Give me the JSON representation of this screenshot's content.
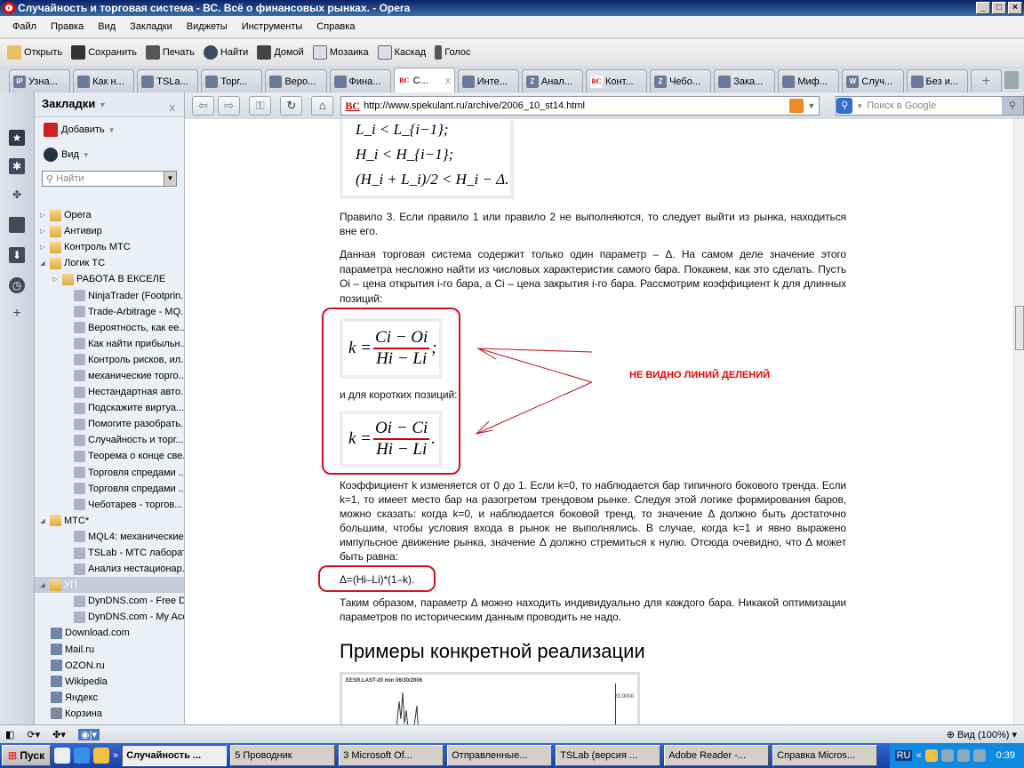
{
  "window": {
    "title": "Случайность и торговая система - ВС. Всё о финансовых рынках. - Opera",
    "controls": [
      "_",
      "□",
      "×"
    ]
  },
  "menu": [
    "Файл",
    "Правка",
    "Вид",
    "Закладки",
    "Виджеты",
    "Инструменты",
    "Справка"
  ],
  "toolbar": [
    "Открыть",
    "Сохранить",
    "Печать",
    "Найти",
    "Домой",
    "Мозаика",
    "Каскад",
    "Голос"
  ],
  "tabs": [
    {
      "label": "Узна...",
      "icon": "IP"
    },
    {
      "label": "Как н...",
      "icon": ""
    },
    {
      "label": "TSLa...",
      "icon": ""
    },
    {
      "label": "Торг...",
      "icon": ""
    },
    {
      "label": "Веро...",
      "icon": ""
    },
    {
      "label": "Фина...",
      "icon": ""
    },
    {
      "label": "С...",
      "icon": "BC",
      "active": true
    },
    {
      "label": "Инте...",
      "icon": ""
    },
    {
      "label": "Анал...",
      "icon": "Z"
    },
    {
      "label": "Конт...",
      "icon": "BC"
    },
    {
      "label": "Чебо...",
      "icon": "Z"
    },
    {
      "label": "Зака...",
      "icon": ""
    },
    {
      "label": "Миф...",
      "icon": ""
    },
    {
      "label": "Случ...",
      "icon": "W"
    },
    {
      "label": "Без и...",
      "icon": ""
    }
  ],
  "tab_close": "x",
  "new_tab": "+",
  "address": {
    "url": "http://www.spekulant.ru/archive/2006_10_st14.html",
    "site_badge": "BC",
    "search_placeholder": "Поиск в Google"
  },
  "panel": {
    "title": "Закладки",
    "close": "x",
    "add": "Добавить",
    "view": "Вид",
    "find_placeholder": "Найти"
  },
  "bookmarks": [
    {
      "label": "Opera",
      "level": 0,
      "type": "folder",
      "arrow": "▷"
    },
    {
      "label": "Антивир",
      "level": 0,
      "type": "folder",
      "arrow": "▷"
    },
    {
      "label": "Контроль МТС",
      "level": 0,
      "type": "folder",
      "arrow": "▷"
    },
    {
      "label": "Логик ТС",
      "level": 0,
      "type": "folder",
      "arrow": "◢"
    },
    {
      "label": "РАБОТА В ЕКСЕЛЕ",
      "level": 1,
      "type": "folder",
      "arrow": "▷"
    },
    {
      "label": "NinjaTrader (Footprin...",
      "level": 2,
      "type": "page"
    },
    {
      "label": "Trade-Arbitrage - MQ...",
      "level": 2,
      "type": "page"
    },
    {
      "label": "Вероятность, как ее...",
      "level": 2,
      "type": "page"
    },
    {
      "label": "Как найти прибыльн...",
      "level": 2,
      "type": "page"
    },
    {
      "label": "Контроль рисков, ил...",
      "level": 2,
      "type": "page"
    },
    {
      "label": "механические торго...",
      "level": 2,
      "type": "page"
    },
    {
      "label": "Нестандартная авто...",
      "level": 2,
      "type": "page"
    },
    {
      "label": "Подскажите виртуа...",
      "level": 2,
      "type": "page"
    },
    {
      "label": "Помогите разобрать...",
      "level": 2,
      "type": "page"
    },
    {
      "label": "Случайность и торг...",
      "level": 2,
      "type": "page"
    },
    {
      "label": "Теорема о конце све...",
      "level": 2,
      "type": "page"
    },
    {
      "label": "Торговля спредами ...",
      "level": 2,
      "type": "page"
    },
    {
      "label": "Торговля спредами ...",
      "level": 2,
      "type": "page"
    },
    {
      "label": "Чеботарев - торгов...",
      "level": 2,
      "type": "page"
    },
    {
      "label": "МТС*",
      "level": 0,
      "type": "folder",
      "arrow": "◢"
    },
    {
      "label": "MQL4: механические...",
      "level": 2,
      "type": "page"
    },
    {
      "label": "TSLab - МТС лаборат...",
      "level": 2,
      "type": "page"
    },
    {
      "label": "Анализ нестационар...",
      "level": 2,
      "type": "page"
    },
    {
      "label": "УП",
      "level": 0,
      "type": "folder",
      "arrow": "◢",
      "selected": true
    },
    {
      "label": "DynDNS.com - Free D...",
      "level": 2,
      "type": "page"
    },
    {
      "label": "DynDNS.com - My Acc...",
      "level": 2,
      "type": "page"
    },
    {
      "label": "Download.com",
      "level": 1,
      "type": "page"
    },
    {
      "label": "Mail.ru",
      "level": 1,
      "type": "page"
    },
    {
      "label": "OZON.ru",
      "level": 1,
      "type": "page"
    },
    {
      "label": "Wikipedia",
      "level": 1,
      "type": "page"
    },
    {
      "label": "Яндекс",
      "level": 1,
      "type": "page"
    },
    {
      "label": "Корзина",
      "level": 1,
      "type": "trash"
    }
  ],
  "article": {
    "sys_lines": [
      "L_i < L_{i−1};",
      "H_i < H_{i−1};",
      "(H_i + L_i)/2 < H_i − Δ."
    ],
    "p1": "Правило 3. Если правило 1 или правило 2 не выполняются, то следует выйти из рынка, находиться вне его.",
    "p2": "Данная торговая система содержит только один параметр – Δ. На самом деле значение этого параметра несложно найти из числовых характеристик самого бара. Покажем, как это сделать. Пусть Oi – цена открытия i-го бара, а Ci – цена закрытия i-го бара. Рассмотрим коэффициент k для длинных позиций:",
    "f1": {
      "lhs": "k =",
      "num": "Ci − Oi",
      "den": "Hi − Li",
      "end": ";"
    },
    "p3": "и для коротких позиций:",
    "f2": {
      "lhs": "k =",
      "num": "Oi − Ci",
      "den": "Hi − Li",
      "end": "."
    },
    "p4": "Коэффициент k изменяется от 0 до 1. Если k=0, то наблюдается бар типичного бокового тренда. Если k=1, то имеет место бар на разогретом трендовом рынке. Следуя этой логике формирования баров, можно сказать: когда k=0, и наблюдается боковой тренд, то значение Δ должно быть достаточно большим, чтобы условия входа в рынок не выполнялись. В случае, когда k=1 и явно выражено импульсное движение рынка, значение Δ должно стремиться к нулю. Отсюда очевидно, что Δ может быть равна:",
    "p5": "Δ=(Hi–Li)*(1–k).",
    "p6": "Таким образом, параметр Δ можно находить индивидуально для каждого бара. Никакой оптимизации параметров по историческим данным проводить не надо.",
    "h2": "Примеры конкретной реализации",
    "chart_caption": "EESR.LAST-20 min 06/30/2006",
    "chart_axis": "20.0000",
    "annotation": "НЕ ВИДНО ЛИНИЙ ДЕЛЕНИЙ"
  },
  "status": {
    "zoom": "Вид (100%)"
  },
  "taskbar": {
    "start": "Пуск",
    "tasks": [
      "Случайность ...",
      "5 Проводник",
      "3 Microsoft Of...",
      "Отправленные...",
      "TSLab (версия ...",
      "Adobe Reader -...",
      "Справка Micros..."
    ],
    "lang": "RU",
    "clock": "0:39"
  },
  "colors": {
    "annotation": "#d01020",
    "titlebar": "#0a246a",
    "taskbar": "#245edb"
  }
}
